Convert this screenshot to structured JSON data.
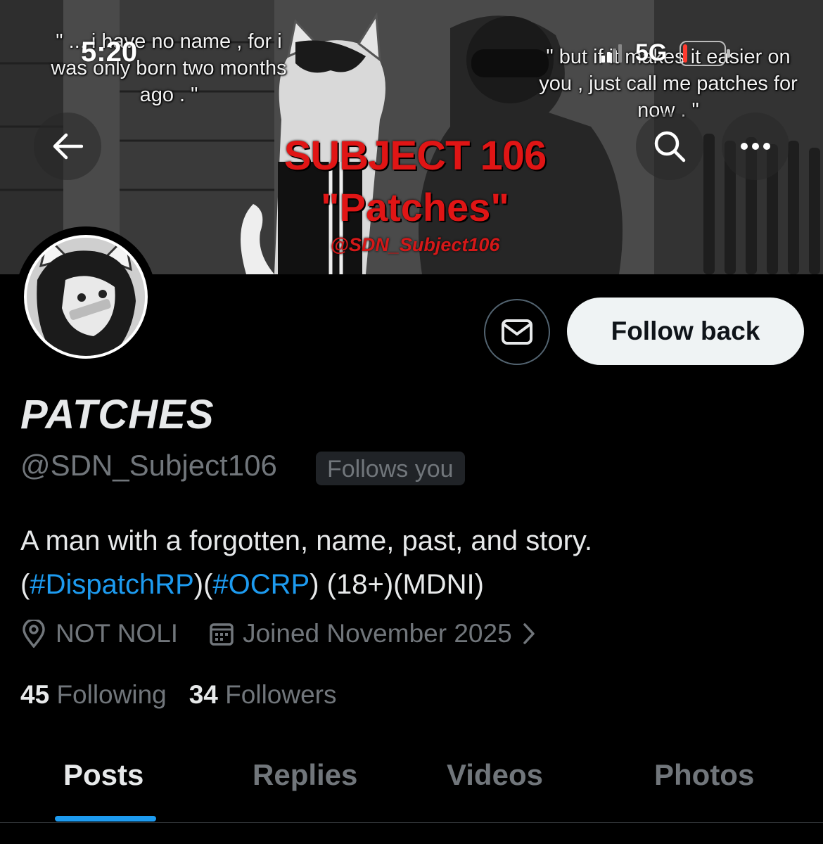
{
  "status_bar": {
    "time": "5:20",
    "network": "5G"
  },
  "banner": {
    "quote_left": "\" ... i have no name , for i was only born two months ago . \"",
    "quote_right": "\" but if it makes it easier on you , just call me patches for now . \"",
    "title_line1": "SUBJECT 106",
    "title_line2": "\"Patches\"",
    "handle": "@SDN_Subject106"
  },
  "nav": {
    "back_icon": "arrow-left-icon",
    "search_icon": "search-icon",
    "more_icon": "more-horizontal-icon"
  },
  "actions": {
    "message_icon": "envelope-icon",
    "follow_label": "Follow back"
  },
  "profile": {
    "display_name": "PATCHES",
    "handle": "@SDN_Subject106",
    "follows_you": "Follows you",
    "bio_line1": "A man with a forgotten, name, past, and story.",
    "bio_open1": "(",
    "bio_tag1": "#DispatchRP",
    "bio_mid": ")(",
    "bio_tag2": "#OCRP",
    "bio_close": ") (18+)(MDNI)",
    "location": "NOT NOLI",
    "joined": "Joined November 2025",
    "following_count": "45",
    "following_label": "Following",
    "followers_count": "34",
    "followers_label": "Followers"
  },
  "tabs": [
    {
      "label": "Posts",
      "active": true
    },
    {
      "label": "Replies",
      "active": false
    },
    {
      "label": "Videos",
      "active": false
    },
    {
      "label": "Photos",
      "active": false
    }
  ],
  "colors": {
    "accent": "#1d9bf0",
    "muted": "#71767b",
    "banner_title": "#e01515"
  }
}
